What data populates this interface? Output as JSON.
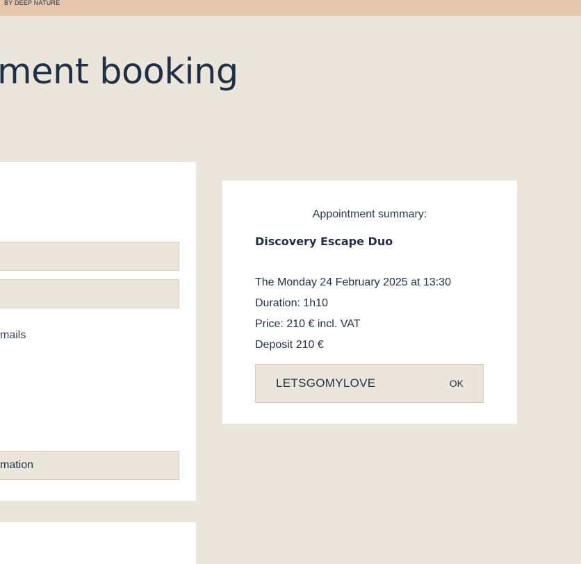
{
  "header": {
    "brand_tagline": "BY DEEP NATURE"
  },
  "page": {
    "title": "ment booking"
  },
  "form": {
    "email_consent_fragment": "mails",
    "submit_label_fragment": "mation"
  },
  "summary": {
    "heading": "Appointment summary:",
    "service_name": "Discovery Escape Duo",
    "date_text": "The Monday 24 February 2025 at 13:30",
    "duration_text": "Duration: 1h10",
    "price_text": "Price: 210 € incl. VAT",
    "deposit_text": "Deposit 210 €",
    "promo_code_value": "LETSGOMYLOVE",
    "promo_ok_label": "OK"
  }
}
